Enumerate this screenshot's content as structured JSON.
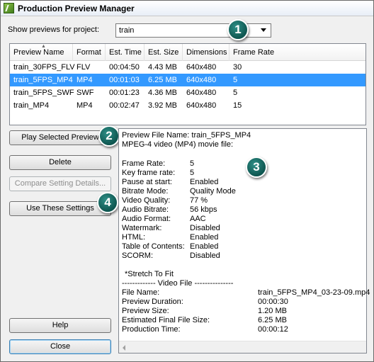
{
  "window": {
    "title": "Production Preview Manager"
  },
  "project": {
    "label": "Show previews for project:",
    "selected": "train"
  },
  "callouts": [
    "1",
    "2",
    "3",
    "4"
  ],
  "list": {
    "columns": [
      "Preview Name",
      "Format",
      "Est. Time",
      "Est. Size",
      "Dimensions",
      "Frame Rate"
    ],
    "rows": [
      {
        "name": "train_30FPS_FLV",
        "format": "FLV",
        "time": "00:04:50",
        "size": "4.43 MB",
        "dimensions": "640x480",
        "frame_rate": "30",
        "selected": false
      },
      {
        "name": "train_5FPS_MP4",
        "format": "MP4",
        "time": "00:01:03",
        "size": "6.25 MB",
        "dimensions": "640x480",
        "frame_rate": "5",
        "selected": true
      },
      {
        "name": "train_5FPS_SWF",
        "format": "SWF",
        "time": "00:01:23",
        "size": "4.36 MB",
        "dimensions": "640x480",
        "frame_rate": "5",
        "selected": false
      },
      {
        "name": "train_MP4",
        "format": "MP4",
        "time": "00:02:47",
        "size": "3.92 MB",
        "dimensions": "640x480",
        "frame_rate": "15",
        "selected": false
      }
    ]
  },
  "buttons": {
    "play": "Play Selected Preview",
    "delete": "Delete",
    "compare": "Compare Setting Details...",
    "use": "Use These Settings",
    "help": "Help",
    "close": "Close"
  },
  "details": {
    "file_name_line": "Preview File Name: train_5FPS_MP4",
    "type_line": "MPEG-4 video (MP4)  movie file:",
    "settings": [
      {
        "label": "Frame Rate:",
        "value": "5"
      },
      {
        "label": "Key frame rate:",
        "value": "5"
      },
      {
        "label": "Pause at start:",
        "value": "Enabled"
      },
      {
        "label": "Bitrate Mode:",
        "value": "Quality Mode"
      },
      {
        "label": "Video Quality:",
        "value": "77 %"
      },
      {
        "label": "Audio Bitrate:",
        "value": "56 kbps"
      },
      {
        "label": "Audio Format:",
        "value": "AAC"
      },
      {
        "label": "Watermark:",
        "value": "Disabled"
      },
      {
        "label": "HTML:",
        "value": "Enabled"
      },
      {
        "label": "Table of Contents:",
        "value": "Enabled"
      },
      {
        "label": "SCORM:",
        "value": "Disabled"
      }
    ],
    "stretch_note": "*Stretch To Fit",
    "video_file_header": "------------- Video File ---------------",
    "video_file": [
      {
        "label": "File Name:",
        "value": "train_5FPS_MP4_03-23-09.mp4"
      },
      {
        "label": "Preview Duration:",
        "value": "00:00:30"
      },
      {
        "label": "Preview Size:",
        "value": "1.20 MB"
      },
      {
        "label": "Estimated Final File Size:",
        "value": "6.25 MB"
      },
      {
        "label": "Production Time:",
        "value": "00:00:12"
      }
    ]
  },
  "colors": {
    "selection": "#3399ff",
    "callout": "#0e5650"
  }
}
